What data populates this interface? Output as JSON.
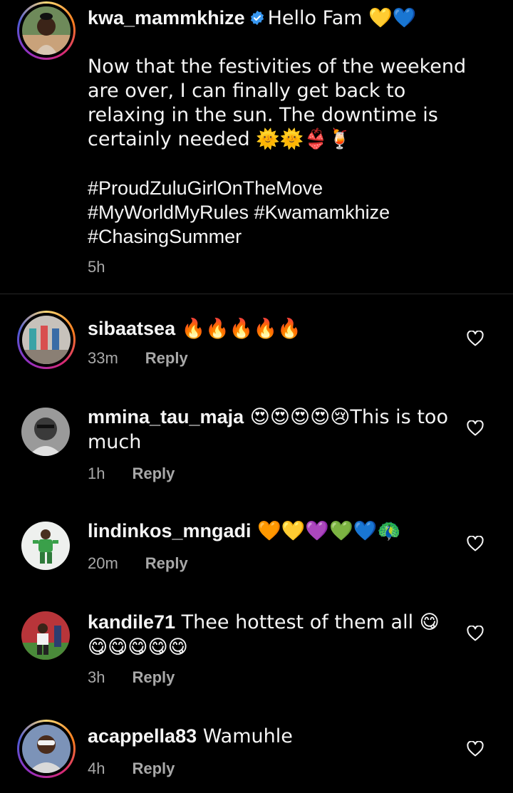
{
  "caption": {
    "username": "kwa_mammkhize",
    "greeting": "Hello Fam 💛💙",
    "paragraph": "Now that the festivities of the weekend are over, I can finally get back to relaxing in the sun. The downtime is certainly needed 🌞🌞👙🍹",
    "hashtags_line1": "#ProudZuluGirlOnTheMove",
    "hashtags_line2": "#MyWorldMyRules #Kwamamkhize",
    "hashtags_line3": "#ChasingSummer",
    "time": "5h"
  },
  "comments": [
    {
      "username": "sibaatsea",
      "text": " 🔥🔥🔥🔥🔥",
      "time": "33m",
      "reply": "Reply"
    },
    {
      "username": "mmina_tau_maja",
      "text": " 😍😍😍😍😢This is too much",
      "time": "1h",
      "reply": "Reply"
    },
    {
      "username": "lindinkos_mngadi",
      "text": " 🧡💛💜💚💙🦚",
      "time": "20m",
      "reply": "Reply"
    },
    {
      "username": "kandile71",
      "text": " Thee hottest of them all 😋😋😋😋😋😋",
      "time": "3h",
      "reply": "Reply"
    },
    {
      "username": "acappella83",
      "text": " Wamuhle",
      "time": "4h",
      "reply": "Reply"
    }
  ]
}
